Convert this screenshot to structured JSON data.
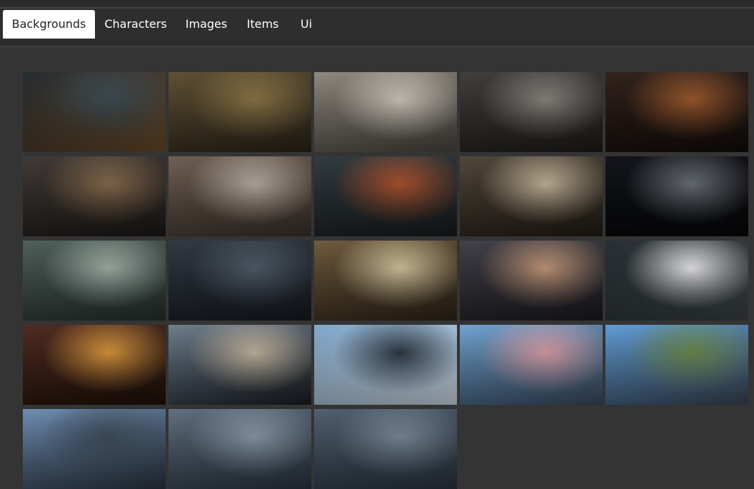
{
  "tabs": [
    {
      "label": "Backgrounds",
      "active": true
    },
    {
      "label": "Characters",
      "active": false
    },
    {
      "label": "Images",
      "active": false
    },
    {
      "label": "Items",
      "active": false
    },
    {
      "label": "Ui",
      "active": false
    }
  ],
  "thumbnails": [
    {
      "row": 1,
      "colors": [
        "#1d2428",
        "#3a4a52",
        "#6a4a2a"
      ]
    },
    {
      "row": 1,
      "colors": [
        "#5a4a2e",
        "#8e7544",
        "#2a2418"
      ]
    },
    {
      "row": 1,
      "colors": [
        "#8a857a",
        "#d2cdc2",
        "#4a4540"
      ]
    },
    {
      "row": 1,
      "colors": [
        "#3a3836",
        "#8a8680",
        "#1e1c1a"
      ]
    },
    {
      "row": 1,
      "colors": [
        "#2a1a14",
        "#a0582a",
        "#120c0a"
      ]
    },
    {
      "row": 2,
      "colors": [
        "#3a3430",
        "#8a6a4a",
        "#1c1816"
      ]
    },
    {
      "row": 2,
      "colors": [
        "#6a5a4e",
        "#bab0a6",
        "#3a302a"
      ]
    },
    {
      "row": 2,
      "colors": [
        "#2a3438",
        "#b0502a",
        "#181c1e"
      ]
    },
    {
      "row": 2,
      "colors": [
        "#4a4034",
        "#c8b89a",
        "#221c16"
      ]
    },
    {
      "row": 2,
      "colors": [
        "#0a0c12",
        "#6a7078",
        "#050608"
      ]
    },
    {
      "row": 3,
      "colors": [
        "#4a5a54",
        "#a4b4ac",
        "#26302c"
      ]
    },
    {
      "row": 3,
      "colors": [
        "#2a323c",
        "#4e5a66",
        "#161a20"
      ]
    },
    {
      "row": 3,
      "colors": [
        "#6a5436",
        "#d8c8a0",
        "#2e2418"
      ]
    },
    {
      "row": 3,
      "colors": [
        "#3c3a42",
        "#c89a7a",
        "#1c1a20"
      ]
    },
    {
      "row": 3,
      "colors": [
        "#20262a",
        "#f0f0f2",
        "#3a4246"
      ]
    },
    {
      "row": 4,
      "colors": [
        "#4a2418",
        "#e09a3a",
        "#1e100a"
      ]
    },
    {
      "row": 4,
      "colors": [
        "#6a7a8a",
        "#c8b8a0",
        "#1a1e22"
      ]
    },
    {
      "row": 4,
      "colors": [
        "#7aa4c8",
        "#2a3440",
        "#d0dce8"
      ]
    },
    {
      "row": 4,
      "colors": [
        "#6aa0d0",
        "#e0a0a8",
        "#3a4a5e"
      ]
    },
    {
      "row": 4,
      "colors": [
        "#5a9ad8",
        "#6a8a4a",
        "#3a4452"
      ]
    },
    {
      "row": 5,
      "colors": [
        "#6a8ab0",
        "#3a4a5a",
        "#2a3440"
      ]
    },
    {
      "row": 5,
      "colors": [
        "#5a6a7a",
        "#8a9aaa",
        "#2a3440"
      ]
    },
    {
      "row": 5,
      "colors": [
        "#4a5a6a",
        "#7a8a9a",
        "#2a3440"
      ]
    }
  ]
}
